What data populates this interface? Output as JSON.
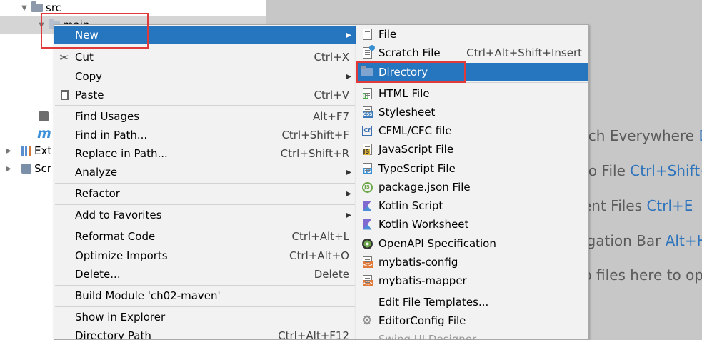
{
  "tree": {
    "src_label": "src",
    "main_label": "main",
    "ext_label": "Ext",
    "scr_label": "Scr",
    "m_label": "m"
  },
  "welcome": {
    "search": {
      "text": "rch Everywhere ",
      "shortcut": "D"
    },
    "goto": {
      "text": "to File ",
      "shortcut": "Ctrl+Shift+"
    },
    "recent": {
      "text": "ent Files ",
      "shortcut": "Ctrl+E"
    },
    "navbar": {
      "text": "igation Bar ",
      "shortcut": "Alt+H"
    },
    "drop": {
      "text": "p files here to op",
      "shortcut": ""
    }
  },
  "context_menu": {
    "new": {
      "label": "New"
    },
    "cut": {
      "label": "Cut",
      "shortcut": "Ctrl+X"
    },
    "copy": {
      "label": "Copy"
    },
    "paste": {
      "label": "Paste",
      "shortcut": "Ctrl+V"
    },
    "find_usages": {
      "label": "Find Usages",
      "shortcut": "Alt+F7"
    },
    "find_in_path": {
      "label": "Find in Path...",
      "shortcut": "Ctrl+Shift+F"
    },
    "replace_in_path": {
      "label": "Replace in Path...",
      "shortcut": "Ctrl+Shift+R"
    },
    "analyze": {
      "label": "Analyze"
    },
    "refactor": {
      "label": "Refactor"
    },
    "add_to_favorites": {
      "label": "Add to Favorites"
    },
    "reformat_code": {
      "label": "Reformat Code",
      "shortcut": "Ctrl+Alt+L"
    },
    "optimize_imports": {
      "label": "Optimize Imports",
      "shortcut": "Ctrl+Alt+O"
    },
    "delete": {
      "label": "Delete...",
      "shortcut": "Delete"
    },
    "build_module": {
      "label": "Build Module 'ch02-maven'"
    },
    "show_in_explorer": {
      "label": "Show in Explorer"
    },
    "directory_path": {
      "label": "Directory Path",
      "shortcut": "Ctrl+Alt+F12"
    }
  },
  "new_submenu": {
    "file": {
      "label": "File"
    },
    "scratch_file": {
      "label": "Scratch File",
      "shortcut": "Ctrl+Alt+Shift+Insert"
    },
    "directory": {
      "label": "Directory"
    },
    "html_file": {
      "label": "HTML File",
      "badge": "H"
    },
    "stylesheet": {
      "label": "Stylesheet",
      "badge": "CSS"
    },
    "cfml": {
      "label": "CFML/CFC file",
      "badge": "Cf"
    },
    "javascript": {
      "label": "JavaScript File",
      "badge": "JS"
    },
    "typescript": {
      "label": "TypeScript File",
      "badge": "TS"
    },
    "package_json": {
      "label": "package.json File",
      "badge": "JS"
    },
    "kotlin_script": {
      "label": "Kotlin Script"
    },
    "kotlin_worksheet": {
      "label": "Kotlin Worksheet"
    },
    "openapi": {
      "label": "OpenAPI Specification"
    },
    "mybatis_config": {
      "label": "mybatis-config"
    },
    "mybatis_mapper": {
      "label": "mybatis-mapper"
    },
    "edit_templates": {
      "label": "Edit File Templates..."
    },
    "editorconfig": {
      "label": "EditorConfig File"
    },
    "swing_designer": {
      "label": "Swing UI Designer"
    }
  },
  "colors": {
    "highlight": "#2675bf",
    "menu_bg": "#f2f2f2",
    "annotation": "#e03a3a",
    "shortcut_link": "#2e74bd"
  }
}
